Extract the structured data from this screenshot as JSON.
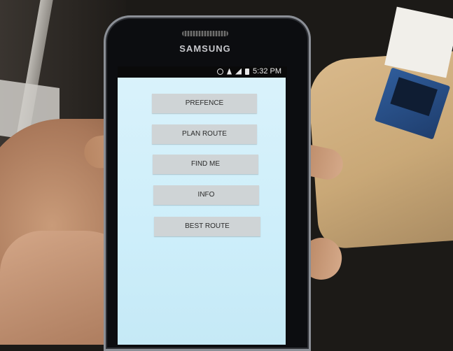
{
  "device": {
    "brand": "SAMSUNG"
  },
  "status_bar": {
    "time": "5:32 PM",
    "icons": [
      "alarm-icon",
      "wifi-icon",
      "signal-icon",
      "battery-icon"
    ]
  },
  "menu": {
    "buttons": [
      {
        "label": "PREFENCE"
      },
      {
        "label": "PLAN ROUTE"
      },
      {
        "label": "FIND ME"
      },
      {
        "label": "INFO"
      },
      {
        "label": "BEST ROUTE"
      }
    ]
  },
  "colors": {
    "screen_background": "#d9f2fb",
    "button_background": "#cfd4d6",
    "button_text": "#2b2b2b"
  }
}
